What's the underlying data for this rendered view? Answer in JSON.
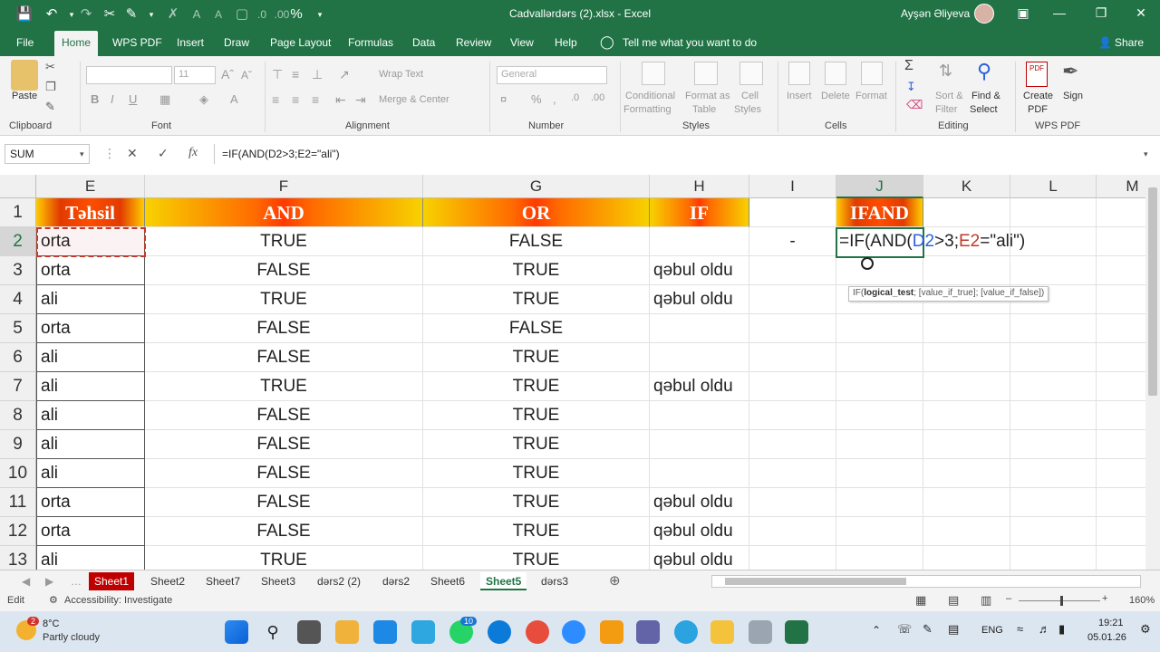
{
  "titlebar": {
    "title": "Cadvallərdərs (2).xlsx  -  Excel",
    "user": "Ayşən Əliyeva",
    "percent": "%"
  },
  "tabs": [
    "File",
    "Home",
    "WPS PDF",
    "Insert",
    "Draw",
    "Page Layout",
    "Formulas",
    "Data",
    "Review",
    "View",
    "Help"
  ],
  "tell_me": "Tell me what you want to do",
  "share": "Share",
  "ribbon": {
    "paste": "Paste",
    "font_size": "11",
    "wrap_text": "Wrap Text",
    "merge_center": "Merge & Center",
    "number_format": "General",
    "conditional": "Conditional",
    "formatting": "Formatting",
    "format_as": "Format as",
    "table": "Table",
    "cell": "Cell",
    "styles_btn": "Styles",
    "insert": "Insert",
    "delete": "Delete",
    "format": "Format",
    "sort": "Sort &",
    "filter": "Filter",
    "find": "Find &",
    "select": "Select",
    "create": "Create",
    "pdf": "PDF",
    "sign": "Sign",
    "groups": {
      "clipboard": "Clipboard",
      "font": "Font",
      "alignment": "Alignment",
      "number": "Number",
      "styles": "Styles",
      "cells": "Cells",
      "editing": "Editing",
      "wps": "WPS PDF"
    }
  },
  "formula_bar": {
    "name_box": "SUM",
    "formula": "=IF(AND(D2>3;E2=\"ali\")"
  },
  "columns": [
    "E",
    "F",
    "G",
    "H",
    "I",
    "J",
    "K",
    "L",
    "M"
  ],
  "headers": {
    "E": "Təhsil",
    "F": "AND",
    "G": "OR",
    "H": "IF",
    "J": "IFAND"
  },
  "rows": [
    {
      "n": "2",
      "E": "orta",
      "F": "TRUE",
      "G": "FALSE",
      "H": "",
      "I": "-"
    },
    {
      "n": "3",
      "E": "orta",
      "F": "FALSE",
      "G": "TRUE",
      "H": "qəbul oldu"
    },
    {
      "n": "4",
      "E": "ali",
      "F": "TRUE",
      "G": "TRUE",
      "H": "qəbul oldu"
    },
    {
      "n": "5",
      "E": "orta",
      "F": "FALSE",
      "G": "FALSE",
      "H": ""
    },
    {
      "n": "6",
      "E": "ali",
      "F": "FALSE",
      "G": "TRUE",
      "H": ""
    },
    {
      "n": "7",
      "E": "ali",
      "F": "TRUE",
      "G": "TRUE",
      "H": "qəbul oldu"
    },
    {
      "n": "8",
      "E": "ali",
      "F": "FALSE",
      "G": "TRUE",
      "H": ""
    },
    {
      "n": "9",
      "E": "ali",
      "F": "FALSE",
      "G": "TRUE",
      "H": ""
    },
    {
      "n": "10",
      "E": "ali",
      "F": "FALSE",
      "G": "TRUE",
      "H": ""
    },
    {
      "n": "11",
      "E": "orta",
      "F": "FALSE",
      "G": "TRUE",
      "H": "qəbul oldu"
    },
    {
      "n": "12",
      "E": "orta",
      "F": "FALSE",
      "G": "TRUE",
      "H": "qəbul oldu"
    },
    {
      "n": "13",
      "E": "ali",
      "F": "TRUE",
      "G": "TRUE",
      "H": "qəbul oldu"
    }
  ],
  "edit_cell": {
    "pre": "=IF(AND(",
    "ref1": "D2",
    ">": ">3;",
    "ref2": "E2",
    "post": "=\"ali\")"
  },
  "tooltip": {
    "fn": "IF(",
    "arg": "logical_test",
    "rest": "; [value_if_true]; [value_if_false])"
  },
  "sheets": [
    "Sheet1",
    "Sheet2",
    "Sheet7",
    "Sheet3",
    "dərs2 (2)",
    "dərs2",
    "Sheet6",
    "Sheet5",
    "dərs3"
  ],
  "status": {
    "mode": "Edit",
    "accessibility": "Accessibility: Investigate",
    "zoom": "160%"
  },
  "taskbar": {
    "temp": "8°C",
    "weather": "Partly cloudy",
    "weather_badge": "2",
    "whatsapp_badge": "10",
    "lang": "ENG",
    "time": "19:21",
    "date": "05.01.26"
  },
  "colors": {
    "accent": "#217346",
    "red_tab": "#c00000",
    "ref1": "#2b62d9",
    "ref2": "#c0392b"
  }
}
